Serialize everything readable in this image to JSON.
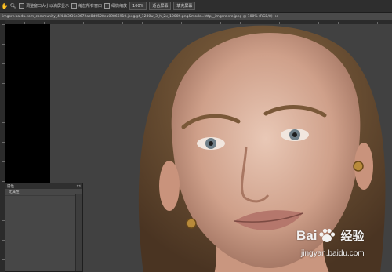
{
  "options_bar": {
    "items": [
      {
        "icon": "hand-icon"
      },
      {
        "icon": "zoom-icon"
      }
    ],
    "checkboxes": [
      {
        "label": "调整窗口大小以满屏显示"
      },
      {
        "label": "缩放所有窗口"
      }
    ],
    "buttons": [
      {
        "label": "细微缩放"
      },
      {
        "label": "100%"
      },
      {
        "label": "适合屏幕"
      },
      {
        "label": "填充屏幕"
      }
    ]
  },
  "document_tab": {
    "title": "imgsrc.baidu.com_community_4f44b3f36e8672ac8d0528ea09866910.jpeg@f_1280w_3_h_2x_1000h.png&mode=http__imgsrc.src.jpeg @ 100% (RGB/8)",
    "close": "×"
  },
  "panel": {
    "title": "属性",
    "collapse": "««",
    "subtitle": "无属性"
  },
  "watermark": {
    "brand": "Bai",
    "brand2": "经验",
    "url": "jingyan.baidu.com"
  }
}
